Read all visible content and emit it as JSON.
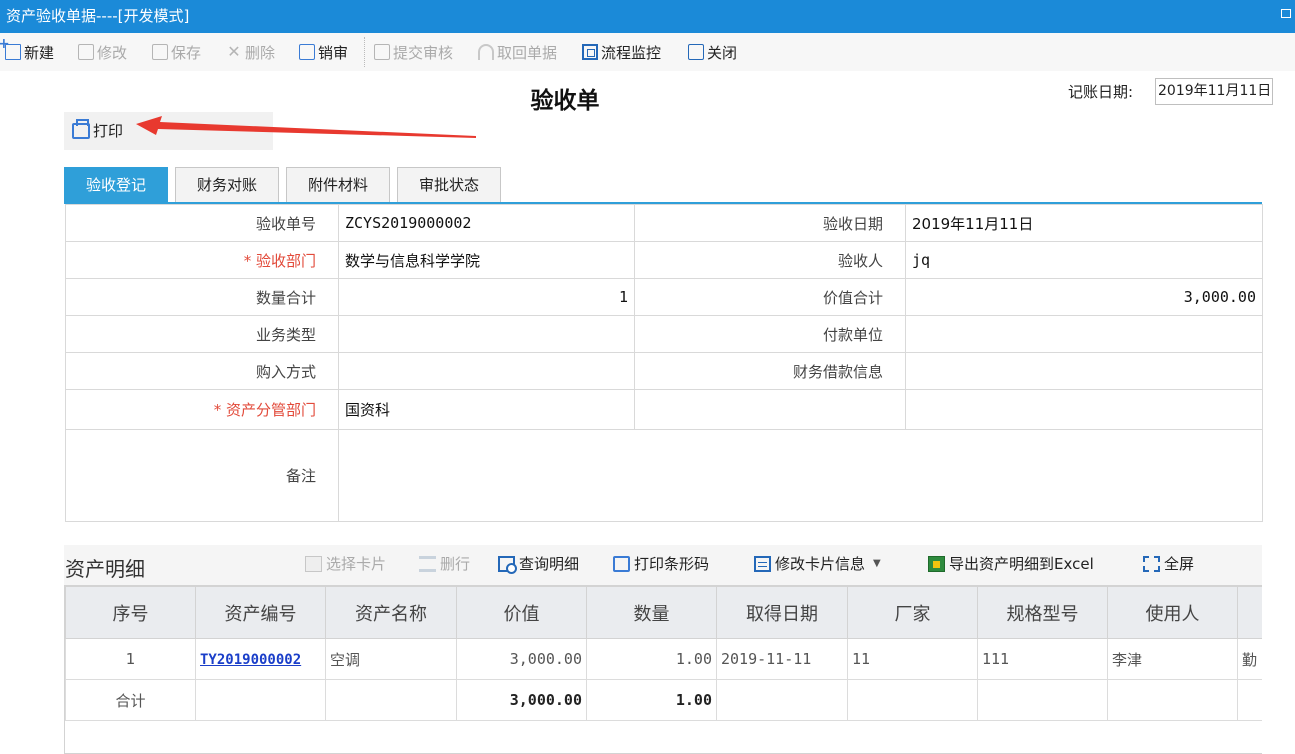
{
  "window": {
    "title": "资产验收单据----[开发模式]"
  },
  "toolbar": {
    "new": "新建",
    "edit": "修改",
    "save": "保存",
    "delete": "删除",
    "cancel_review": "销审",
    "submit": "提交审核",
    "retrieve": "取回单据",
    "monitor": "流程监控",
    "close": "关闭"
  },
  "document": {
    "title": "验收单",
    "date_label": "记账日期:",
    "date_value": "2019年11月11日"
  },
  "print": {
    "label": "打印"
  },
  "tabs": [
    "验收登记",
    "财务对账",
    "附件材料",
    "审批状态"
  ],
  "form": {
    "rows": [
      {
        "l1": "验收单号",
        "v1": "ZCYS2019000002",
        "l2": "验收日期",
        "v2": "2019年11月11日"
      },
      {
        "l1": "* 验收部门",
        "v1": "数学与信息科学学院",
        "l2": "验收人",
        "v2": "jq"
      },
      {
        "l1": "数量合计",
        "v1": "1",
        "l2": "价值合计",
        "v2": "3,000.00"
      },
      {
        "l1": "业务类型",
        "v1": "",
        "l2": "付款单位",
        "v2": ""
      },
      {
        "l1": "购入方式",
        "v1": "",
        "l2": "财务借款信息",
        "v2": ""
      },
      {
        "l1": "* 资产分管部门",
        "v1": "国资科",
        "l2": "",
        "v2": ""
      }
    ],
    "remark_label": "备注",
    "remark_value": ""
  },
  "detail": {
    "title": "资产明细",
    "actions": {
      "select_card": "选择卡片",
      "delete_row": "删行",
      "query_detail": "查询明细",
      "print_barcode": "打印条形码",
      "edit_card": "修改卡片信息",
      "export_excel": "导出资产明细到Excel",
      "fullscreen": "全屏"
    },
    "columns": [
      "序号",
      "资产编号",
      "资产名称",
      "价值",
      "数量",
      "取得日期",
      "厂家",
      "规格型号",
      "使用人",
      ""
    ],
    "rows": [
      {
        "no": "1",
        "code": "TY2019000002",
        "name": "空调",
        "value": "3,000.00",
        "qty": "1.00",
        "date": "2019-11-11",
        "maker": "11",
        "spec": "111",
        "user": "李津",
        "extra": "勤"
      }
    ],
    "total": {
      "label": "合计",
      "value": "3,000.00",
      "qty": "1.00"
    }
  }
}
